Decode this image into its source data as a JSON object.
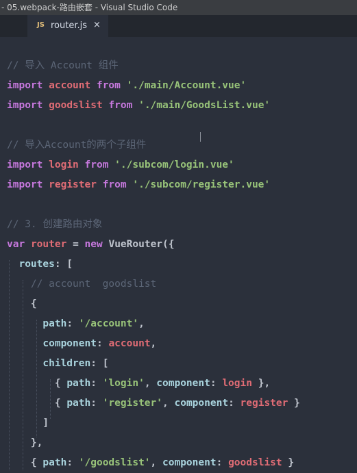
{
  "window": {
    "title": "- 05.webpack-路由嵌套 - Visual Studio Code"
  },
  "tabs": [
    {
      "icon": "JS",
      "label": "router.js",
      "close": "×"
    }
  ],
  "code": {
    "c1": "// 导入 Account 组件",
    "l1": {
      "kw1": "import",
      "id": "account",
      "kw2": "from",
      "str": "'./main/Account.vue'"
    },
    "l2": {
      "kw1": "import",
      "id": "goodslist",
      "kw2": "from",
      "str": "'./main/GoodsList.vue'"
    },
    "c2": "// 导入Account的两个子组件",
    "l3": {
      "kw1": "import",
      "id": "login",
      "kw2": "from",
      "str": "'./subcom/login.vue'"
    },
    "l4": {
      "kw1": "import",
      "id": "register",
      "kw2": "from",
      "str": "'./subcom/register.vue'"
    },
    "c3": "// 3. 创建路由对象",
    "l5": {
      "kw1": "var",
      "id": "router",
      "eq": "=",
      "kw2": "new",
      "cls": "VueRouter({"
    },
    "l6": {
      "prop": "routes",
      "rest": ": ["
    },
    "c4": "// account  goodslist",
    "l7": "{",
    "l8": {
      "prop": "path",
      "colon": ": ",
      "str": "'/account'",
      "comma": ","
    },
    "l9": {
      "prop": "component",
      "colon": ": ",
      "id": "account",
      "comma": ","
    },
    "l10": {
      "prop": "children",
      "rest": ": ["
    },
    "l11": {
      "open": "{ ",
      "prop1": "path",
      "colon1": ": ",
      "str": "'login'",
      "sep": ", ",
      "prop2": "component",
      "colon2": ": ",
      "id": "login",
      "close": " },"
    },
    "l12": {
      "open": "{ ",
      "prop1": "path",
      "colon1": ": ",
      "str": "'register'",
      "sep": ", ",
      "prop2": "component",
      "colon2": ": ",
      "id": "register",
      "close": " }"
    },
    "l13": "]",
    "l14": "},",
    "l15": {
      "open": "{ ",
      "prop1": "path",
      "colon1": ": ",
      "str": "'/goodslist'",
      "sep": ", ",
      "prop2": "component",
      "colon2": ": ",
      "id": "goodslist",
      "close": " }"
    }
  }
}
